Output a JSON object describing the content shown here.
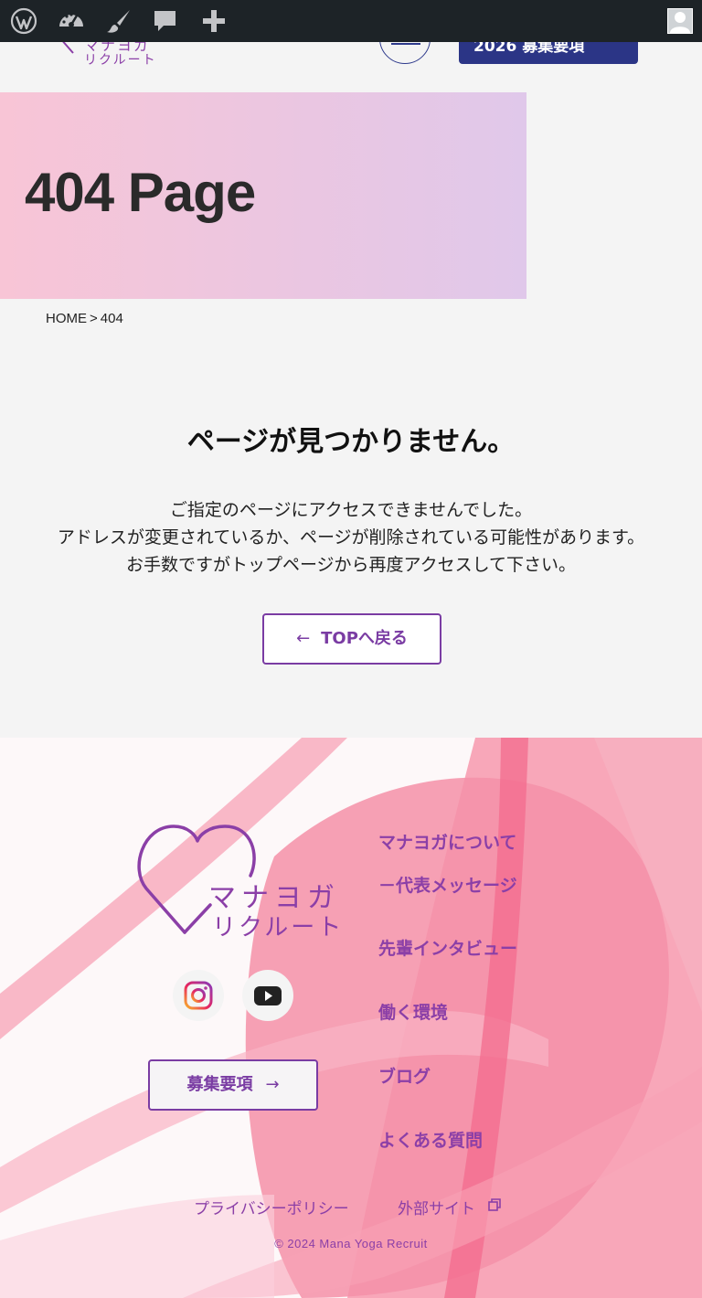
{
  "admin_bar": {
    "icons": [
      "wordpress-icon",
      "dashboard-icon",
      "customize-brush-icon",
      "comments-icon",
      "new-plus-icon",
      "user-avatar"
    ]
  },
  "header": {
    "logo_line1": "マナヨガ",
    "logo_line2": "リクルート",
    "recruit_button": "2026 募集要項"
  },
  "hero": {
    "title": "404 Page"
  },
  "breadcrumb": {
    "home": "HOME",
    "separator": ">",
    "current": "404"
  },
  "main": {
    "heading": "ページが見つかりません。",
    "message_lines": [
      "ご指定のページにアクセスできませんでした。",
      "アドレスが変更されているか、ページが削除されている可能性があります。",
      "お手数ですがトップページから再度アクセスして下さい。"
    ],
    "back_arrow": "←",
    "back_button": "TOPへ戻る"
  },
  "footer": {
    "logo_line1": "マナヨガ",
    "logo_line2": "リクルート",
    "sns": [
      "instagram-icon",
      "youtube-icon"
    ],
    "recruit_button": "募集要項",
    "recruit_arrow": "→",
    "nav": [
      "マナヨガについて",
      "－代表メッセージ",
      "先輩インタビュー",
      "働く環境",
      "ブログ",
      "よくある質問"
    ],
    "privacy": "プライバシーポリシー",
    "external": "外部サイト",
    "copyright": "© 2024 Mana Yoga Recruit"
  },
  "colors": {
    "admin_bar": "#1d2327",
    "brand_purple": "#8b3fa7",
    "brand_navy": "#2b3586",
    "footer_pink": "#f47a98"
  }
}
